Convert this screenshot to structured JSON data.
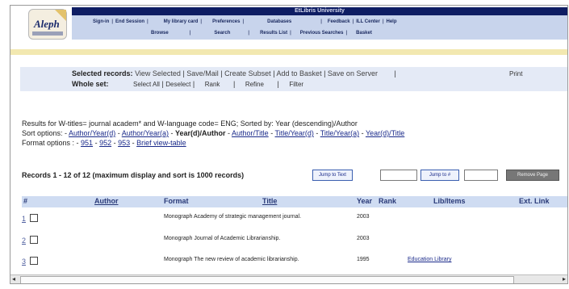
{
  "header": {
    "logo_text": "Aleph",
    "university": "EtLibris University",
    "nav_row1": [
      "Sign-in",
      "End Session",
      "My library card",
      "Preferences",
      "Databases",
      "Feedback",
      "ILL Center",
      "Help"
    ],
    "nav_row2": [
      "Browse",
      "Search",
      "Results List",
      "Previous Searches",
      "Basket"
    ]
  },
  "actions": {
    "selected_label": "Selected records:",
    "selected_links": [
      "View Selected",
      "Save/Mail",
      "Create Subset",
      "Add to Basket",
      "Save on Server"
    ],
    "print_label": "Print",
    "whole_label": "Whole set:",
    "whole_links": [
      "Select All",
      "Deselect",
      "Rank",
      "Refine",
      "Filter"
    ]
  },
  "results": {
    "summary": "Results for W-titles= journal academ* and W-language code= ENG; Sorted by: Year (descending)/Author",
    "sort_label": "Sort options:",
    "sort_options": [
      "Author/Year(d)",
      "Author/Year(a)",
      "Year(d)/Author",
      "Author/Title",
      "Title/Year(d)",
      "Title/Year(a)",
      "Year(d)/Title"
    ],
    "format_label": "Format options :",
    "format_options": [
      "951",
      "952",
      "953",
      "Brief view-table"
    ],
    "records_text": "Records 1 - 12 of 12 (maximum display and sort is 1000 records)",
    "jump_text_btn": "Jump to Text",
    "jump_num_btn": "Jump to #",
    "remove_btn": "Remove Page"
  },
  "table": {
    "headers": [
      "#",
      "Author",
      "Format",
      "Title",
      "Year",
      "Rank",
      "Lib/Items",
      "Ext. Link"
    ],
    "rows": [
      {
        "no": "1",
        "format_title": "Monograph Academy of strategic management journal.",
        "year": "2003",
        "lib": ""
      },
      {
        "no": "2",
        "format_title": "Monograph Journal of Academic Librarianship.",
        "year": "2003",
        "lib": ""
      },
      {
        "no": "3",
        "format_title": "Monograph The new review of academic librarianship.",
        "year": "1995",
        "lib": "Education Library"
      }
    ]
  }
}
